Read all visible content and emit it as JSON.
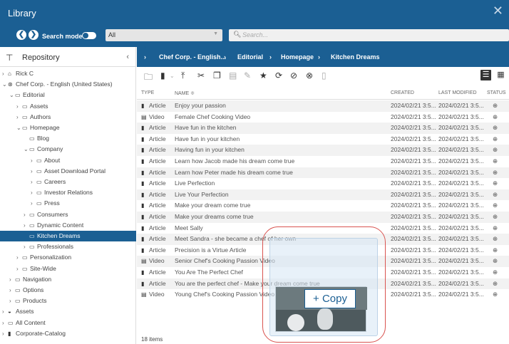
{
  "window": {
    "title": "Library",
    "close": "✕"
  },
  "searchbar": {
    "mode_label": "Search mode",
    "select_value": "All",
    "search_placeholder": "Search..."
  },
  "repository": {
    "title": "Repository"
  },
  "tree": [
    {
      "label": "Rick C",
      "icon": "home-icon",
      "level": 0,
      "arrow": "›"
    },
    {
      "label": "Chef Corp. - English (United States)",
      "icon": "globe-icon",
      "level": 0,
      "arrow": "⌄"
    },
    {
      "label": "Editorial",
      "icon": "folder-icon",
      "level": 1,
      "arrow": "⌄"
    },
    {
      "label": "Assets",
      "icon": "folder-icon",
      "level": 2,
      "arrow": "›"
    },
    {
      "label": "Authors",
      "icon": "folder-icon",
      "level": 2,
      "arrow": "›"
    },
    {
      "label": "Homepage",
      "icon": "folder-icon",
      "level": 2,
      "arrow": "⌄"
    },
    {
      "label": "Blog",
      "icon": "folder-icon",
      "level": 3,
      "arrow": ""
    },
    {
      "label": "Company",
      "icon": "folder-icon",
      "level": 3,
      "arrow": "⌄"
    },
    {
      "label": "About",
      "icon": "folder-icon",
      "level": 4,
      "arrow": "›"
    },
    {
      "label": "Asset Download Portal",
      "icon": "folder-icon",
      "level": 4,
      "arrow": "›"
    },
    {
      "label": "Careers",
      "icon": "folder-icon",
      "level": 4,
      "arrow": "›"
    },
    {
      "label": "Investor Relations",
      "icon": "folder-icon",
      "level": 4,
      "arrow": "›"
    },
    {
      "label": "Press",
      "icon": "folder-icon",
      "level": 4,
      "arrow": "›"
    },
    {
      "label": "Consumers",
      "icon": "folder-icon",
      "level": 3,
      "arrow": "›"
    },
    {
      "label": "Dynamic Content",
      "icon": "folder-icon",
      "level": 3,
      "arrow": "›"
    },
    {
      "label": "Kitchen Dreams",
      "icon": "folder-icon",
      "level": 3,
      "arrow": "",
      "selected": true
    },
    {
      "label": "Professionals",
      "icon": "folder-icon",
      "level": 3,
      "arrow": "›"
    },
    {
      "label": "Personalization",
      "icon": "folder-icon",
      "level": 2,
      "arrow": "›"
    },
    {
      "label": "Site-Wide",
      "icon": "folder-icon",
      "level": 2,
      "arrow": "›"
    },
    {
      "label": "Navigation",
      "icon": "folder-icon",
      "level": 1,
      "arrow": "›"
    },
    {
      "label": "Options",
      "icon": "folder-icon",
      "level": 1,
      "arrow": "›"
    },
    {
      "label": "Products",
      "icon": "folder-icon",
      "level": 1,
      "arrow": "›"
    },
    {
      "label": "Assets",
      "icon": "asset-icon",
      "level": 0,
      "arrow": "›"
    },
    {
      "label": "All Content",
      "icon": "folder-icon",
      "level": 0,
      "arrow": "›"
    },
    {
      "label": "Corporate-Catalog",
      "icon": "catalog-icon",
      "level": 0,
      "arrow": "›"
    }
  ],
  "breadcrumb": [
    "Chef Corp. - English...",
    "Editorial",
    "Homepage",
    "Kitchen Dreams"
  ],
  "columns": {
    "type": "TYPE",
    "name": "NAME ≑",
    "created": "CREATED",
    "modified": "LAST MODIFIED",
    "status": "STATUS"
  },
  "rows": [
    {
      "type": "Article",
      "name": "Enjoy your passion",
      "created": "2024/02/21 3:5...",
      "modified": "2024/02/21 3:5..."
    },
    {
      "type": "Video",
      "name": "Female Chef Cooking Video",
      "created": "2024/02/21 3:5...",
      "modified": "2024/02/21 3:5..."
    },
    {
      "type": "Article",
      "name": "Have fun in the kitchen",
      "created": "2024/02/21 3:5...",
      "modified": "2024/02/21 3:5..."
    },
    {
      "type": "Article",
      "name": "Have fun in your kitchen",
      "created": "2024/02/21 3:5...",
      "modified": "2024/02/21 3:5..."
    },
    {
      "type": "Article",
      "name": "Having fun in your kitchen",
      "created": "2024/02/21 3:5...",
      "modified": "2024/02/21 3:5..."
    },
    {
      "type": "Article",
      "name": "Learn how Jacob made his dream come true",
      "created": "2024/02/21 3:5...",
      "modified": "2024/02/21 3:5..."
    },
    {
      "type": "Article",
      "name": "Learn how Peter made his dream come true",
      "created": "2024/02/21 3:5...",
      "modified": "2024/02/21 3:5..."
    },
    {
      "type": "Article",
      "name": "Live Perfection",
      "created": "2024/02/21 3:5...",
      "modified": "2024/02/21 3:5..."
    },
    {
      "type": "Article",
      "name": "Live Your Perfection",
      "created": "2024/02/21 3:5...",
      "modified": "2024/02/21 3:5..."
    },
    {
      "type": "Article",
      "name": "Make your dream come true",
      "created": "2024/02/21 3:5...",
      "modified": "2024/02/21 3:5..."
    },
    {
      "type": "Article",
      "name": "Make your dreams come true",
      "created": "2024/02/21 3:5...",
      "modified": "2024/02/21 3:5..."
    },
    {
      "type": "Article",
      "name": "Meet Sally",
      "created": "2024/02/21 3:5...",
      "modified": "2024/02/21 3:5..."
    },
    {
      "type": "Article",
      "name": "Meet Sandra - she became a chef of her own",
      "created": "2024/02/21 3:5...",
      "modified": "2024/02/21 3:5..."
    },
    {
      "type": "Article",
      "name": "Precision is a Virtue Article",
      "created": "2024/02/21 3:5...",
      "modified": "2024/02/21 3:5..."
    },
    {
      "type": "Video",
      "name": "Senior Chef's Cooking Passion Video",
      "created": "2024/02/21 3:5...",
      "modified": "2024/02/21 3:5..."
    },
    {
      "type": "Article",
      "name": "You Are The Perfect Chef",
      "created": "2024/02/21 3:5...",
      "modified": "2024/02/21 3:5..."
    },
    {
      "type": "Article",
      "name": "You are the perfect chef - Make your dream come true",
      "created": "2024/02/21 3:5...",
      "modified": "2024/02/21 3:5..."
    },
    {
      "type": "Video",
      "name": "Young Chef's Cooking Passion Video",
      "created": "2024/02/21 3:5...",
      "modified": "2024/02/21 3:5..."
    }
  ],
  "footer": {
    "count": "18 items"
  },
  "drag": {
    "copy_label": "+ Copy"
  },
  "colors": {
    "brand": "#1b5f93",
    "highlight": "#d9534f"
  }
}
